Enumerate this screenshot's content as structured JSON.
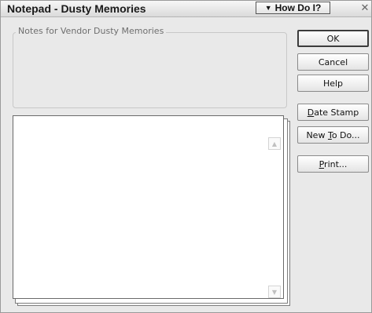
{
  "window": {
    "title": "Notepad - Dusty Memories",
    "how_do_i_label": "How Do I?",
    "how_do_i_icon": "triangle-down-icon",
    "close_glyph": "✕"
  },
  "notes_header": {
    "label": "Notes for Vendor Dusty Memories"
  },
  "notepad": {
    "content": ""
  },
  "buttons": {
    "ok": {
      "label": "OK"
    },
    "cancel": {
      "label": "Cancel"
    },
    "help": {
      "label": "Help"
    },
    "date_stamp": {
      "accel": "D",
      "label_rest": "ate Stamp"
    },
    "new_todo": {
      "before": "New ",
      "accel": "T",
      "after": "o Do..."
    },
    "print": {
      "accel": "P",
      "label_rest": "rint..."
    }
  }
}
